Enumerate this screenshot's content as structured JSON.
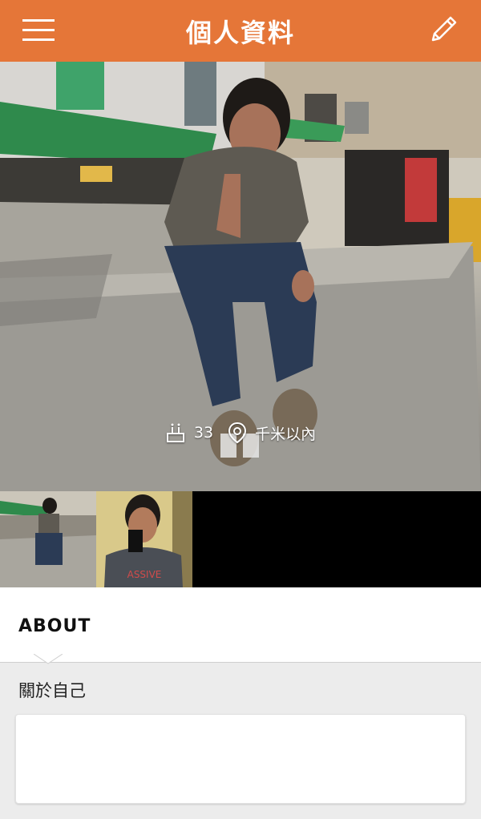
{
  "header": {
    "title": "個人資料",
    "menu_icon": "hamburger-menu-icon",
    "edit_icon": "pencil-edit-icon",
    "background_color": "#e57638"
  },
  "profile": {
    "age": "33",
    "age_icon": "birthday-cake-icon",
    "distance": "千米以內",
    "distance_icon": "location-pin-icon"
  },
  "photos": {
    "count": 2
  },
  "about": {
    "section_title": "ABOUT",
    "self_label": "關於自己",
    "self_text": ""
  }
}
